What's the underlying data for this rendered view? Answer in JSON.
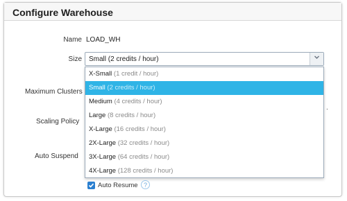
{
  "dialog": {
    "title": "Configure Warehouse"
  },
  "fields": {
    "name_label": "Name",
    "name_value": "LOAD_WH",
    "size_label": "Size",
    "max_clusters_label": "Maximum Clusters",
    "scaling_policy_label": "Scaling Policy",
    "auto_suspend_label": "Auto Suspend"
  },
  "size_select": {
    "selected_value": "Small  (2 credits / hour)",
    "arrow_icon": "chevron-down-icon"
  },
  "size_options": [
    {
      "size": "X-Small",
      "credits": "(1 credit / hour)",
      "selected": false
    },
    {
      "size": "Small",
      "credits": "(2 credits / hour)",
      "selected": true
    },
    {
      "size": "Medium",
      "credits": "(4 credits / hour)",
      "selected": false
    },
    {
      "size": "Large",
      "credits": "(8 credits / hour)",
      "selected": false
    },
    {
      "size": "X-Large",
      "credits": "(16 credits / hour)",
      "selected": false
    },
    {
      "size": "2X-Large",
      "credits": "(32 credits / hour)",
      "selected": false
    },
    {
      "size": "3X-Large",
      "credits": "(64 credits / hour)",
      "selected": false
    },
    {
      "size": "4X-Large",
      "credits": "(128 credits / hour)",
      "selected": false
    }
  ],
  "partial_text": ".",
  "auto_resume": {
    "label": "Auto Resume",
    "checked": true,
    "help_icon": "help-icon",
    "help_glyph": "?"
  },
  "colors": {
    "highlight": "#2fb4e6",
    "checkbox": "#2a7fd0"
  }
}
